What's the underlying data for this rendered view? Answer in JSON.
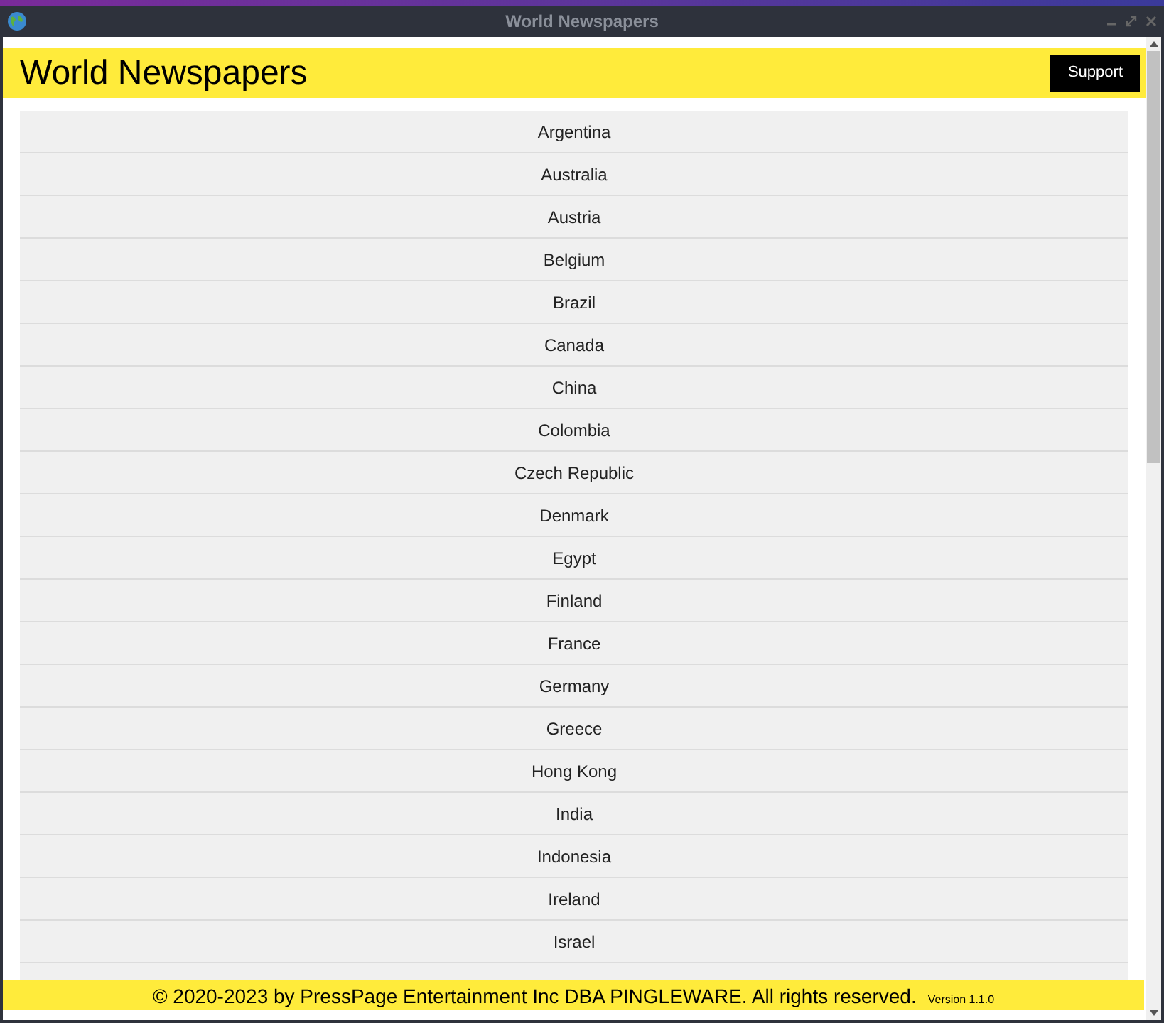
{
  "window": {
    "title": "World Newspapers"
  },
  "header": {
    "title": "World Newspapers",
    "support_button": "Support"
  },
  "countries": [
    "Argentina",
    "Australia",
    "Austria",
    "Belgium",
    "Brazil",
    "Canada",
    "China",
    "Colombia",
    "Czech Republic",
    "Denmark",
    "Egypt",
    "Finland",
    "France",
    "Germany",
    "Greece",
    "Hong Kong",
    "India",
    "Indonesia",
    "Ireland",
    "Israel"
  ],
  "footer": {
    "copyright": "© 2020-2023 by PressPage Entertainment Inc DBA PINGLEWARE. All rights reserved.",
    "version": "Version 1.1.0"
  }
}
